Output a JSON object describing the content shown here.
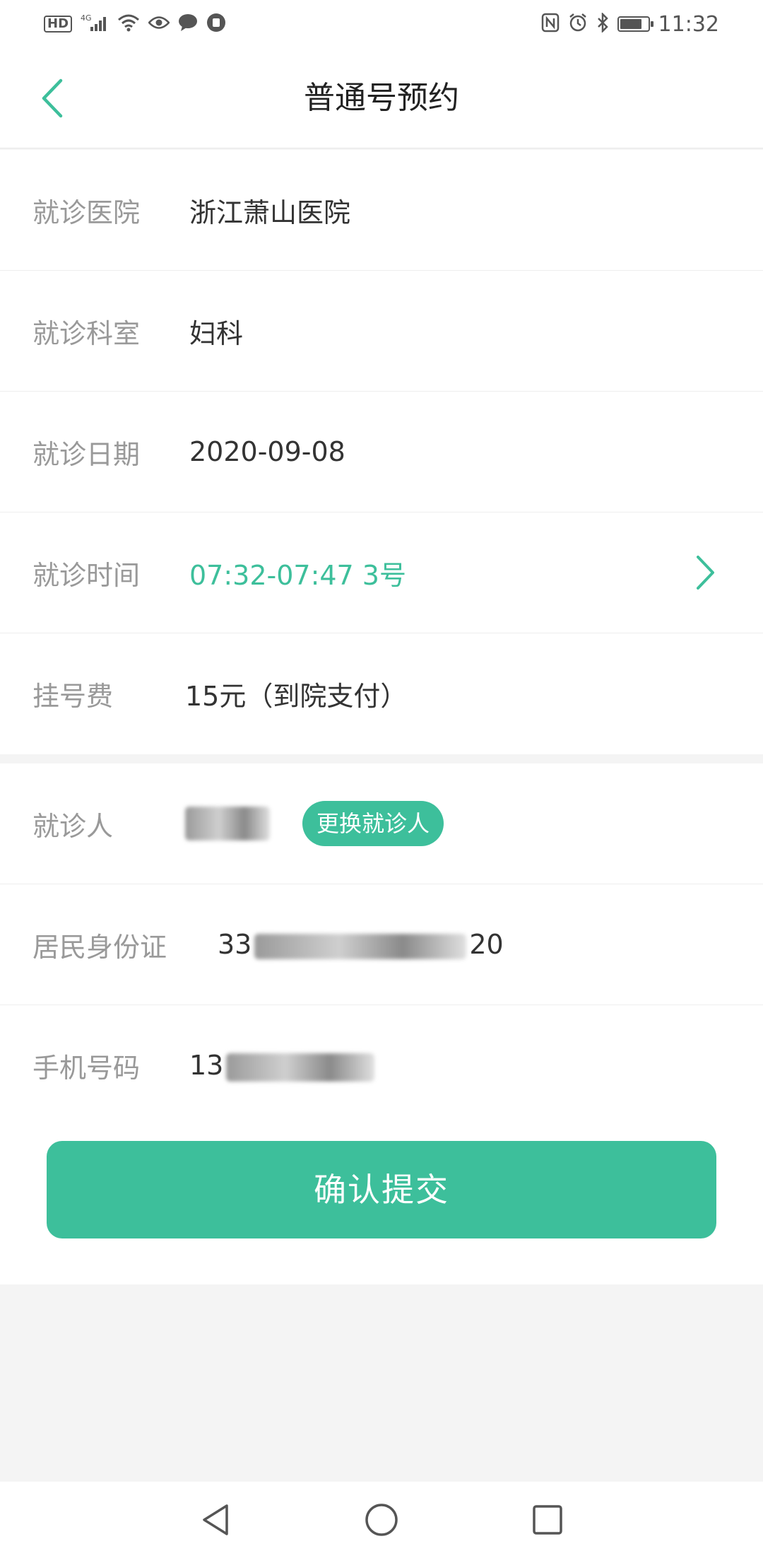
{
  "status_bar": {
    "network": "4G",
    "hd_label": "HD",
    "time": "11:32",
    "battery_level": 0.8,
    "icons": [
      "hd-icon",
      "signal-icon",
      "wifi-icon",
      "eye-icon",
      "chat-icon",
      "shield-icon",
      "nfc-icon",
      "alarm-icon",
      "bluetooth-icon",
      "battery-icon"
    ]
  },
  "header": {
    "title": "普通号预约",
    "back_icon": "chevron-left-icon"
  },
  "appointment": {
    "rows": [
      {
        "label": "就诊医院",
        "value": "浙江萧山医院"
      },
      {
        "label": "就诊科室",
        "value": "妇科"
      },
      {
        "label": "就诊日期",
        "value": "2020-09-08"
      },
      {
        "label": "就诊时间",
        "value": "07:32-07:47 3号"
      },
      {
        "label": "挂号费",
        "value": "15元（到院支付）"
      }
    ]
  },
  "patient": {
    "patient_label": "就诊人",
    "change_button": "更换就诊人",
    "id_label": "居民身份证",
    "id_prefix": "33",
    "id_suffix": "20",
    "phone_label": "手机号码",
    "phone_prefix": "13"
  },
  "submit": {
    "label": "确认提交"
  },
  "colors": {
    "accent": "#3dbf9b",
    "label": "#999999",
    "text": "#333333"
  }
}
